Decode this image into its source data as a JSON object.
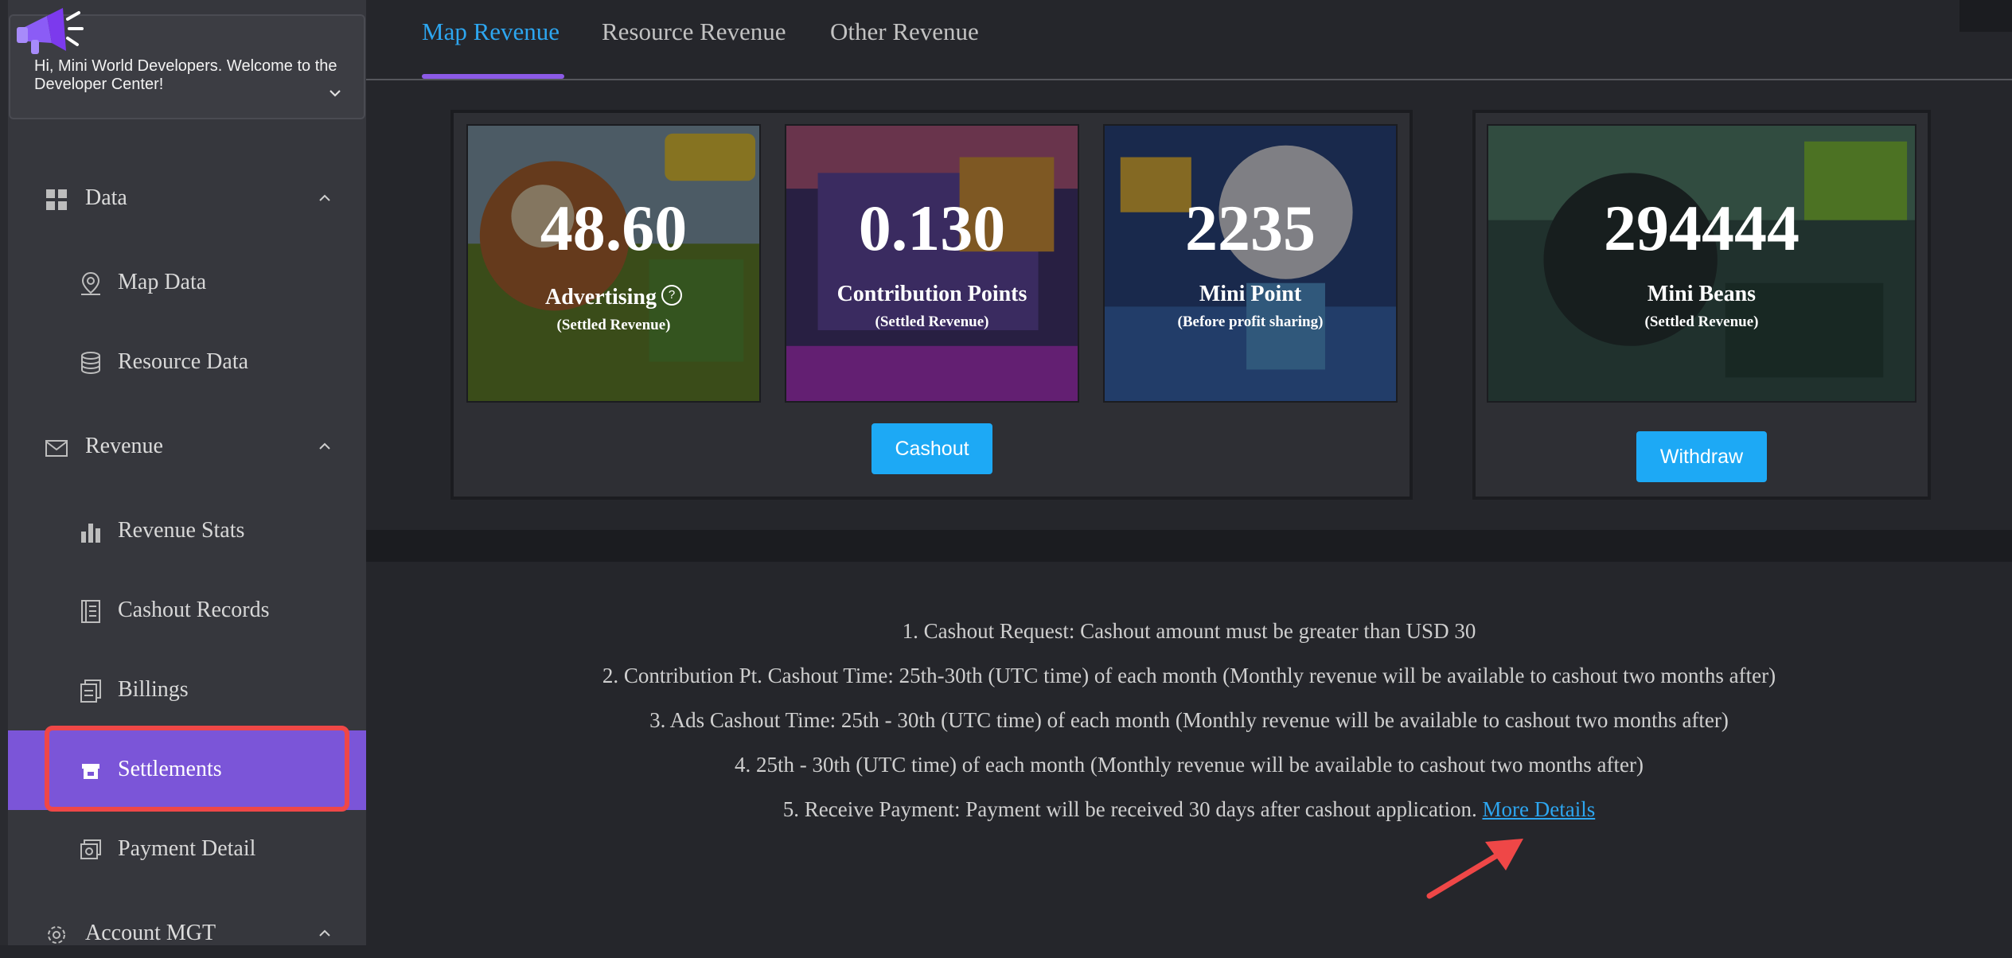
{
  "sidebar": {
    "welcome": "Hi, Mini World Developers. Welcome to the Developer Center!",
    "groups": [
      {
        "label": "Data",
        "icon": "grid-icon"
      },
      {
        "label": "Revenue",
        "icon": "envelope-icon"
      },
      {
        "label": "Account MGT",
        "icon": "gear-icon"
      }
    ],
    "items": [
      {
        "label": "Map Data",
        "icon": "map-pin-icon"
      },
      {
        "label": "Resource Data",
        "icon": "database-icon"
      },
      {
        "label": "Revenue Stats",
        "icon": "bar-chart-icon"
      },
      {
        "label": "Cashout Records",
        "icon": "ledger-icon"
      },
      {
        "label": "Billings",
        "icon": "billing-icon"
      },
      {
        "label": "Settlements",
        "icon": "settlement-icon",
        "active": true
      },
      {
        "label": "Payment Detail",
        "icon": "payment-icon"
      }
    ]
  },
  "tabs": [
    {
      "label": "Map Revenue",
      "active": true
    },
    {
      "label": "Resource Revenue"
    },
    {
      "label": "Other Revenue"
    }
  ],
  "cards": [
    {
      "value": "48.60",
      "label": "Advertising",
      "sub": "(Settled Revenue)",
      "help": "?"
    },
    {
      "value": "0.130",
      "label": "Contribution Points",
      "sub": "(Settled Revenue)"
    },
    {
      "value": "2235",
      "label": "Mini Point",
      "sub": "(Before profit sharing)"
    },
    {
      "value": "294444",
      "label": "Mini Beans",
      "sub": "(Settled Revenue)"
    }
  ],
  "buttons": {
    "cashout": "Cashout",
    "withdraw": "Withdraw"
  },
  "notes": [
    "1. Cashout Request: Cashout amount must be greater than USD 30",
    "2. Contribution Pt. Cashout Time: 25th-30th (UTC time) of each month (Monthly revenue will be available to cashout two months after)",
    "3. Ads Cashout Time: 25th - 30th (UTC time) of each month (Monthly revenue will be available to cashout two months after)",
    "4. 25th - 30th (UTC time) of each month (Monthly revenue will be available to cashout two months after)",
    "5. Receive Payment: Payment will be received 30 days after cashout application."
  ],
  "more_details": "More Details",
  "colors": {
    "accent": "#2da6f0",
    "active_nav": "#7b55d8",
    "highlight_box": "#ef4747",
    "button": "#1da9f5",
    "arrow": "#ef4747"
  }
}
